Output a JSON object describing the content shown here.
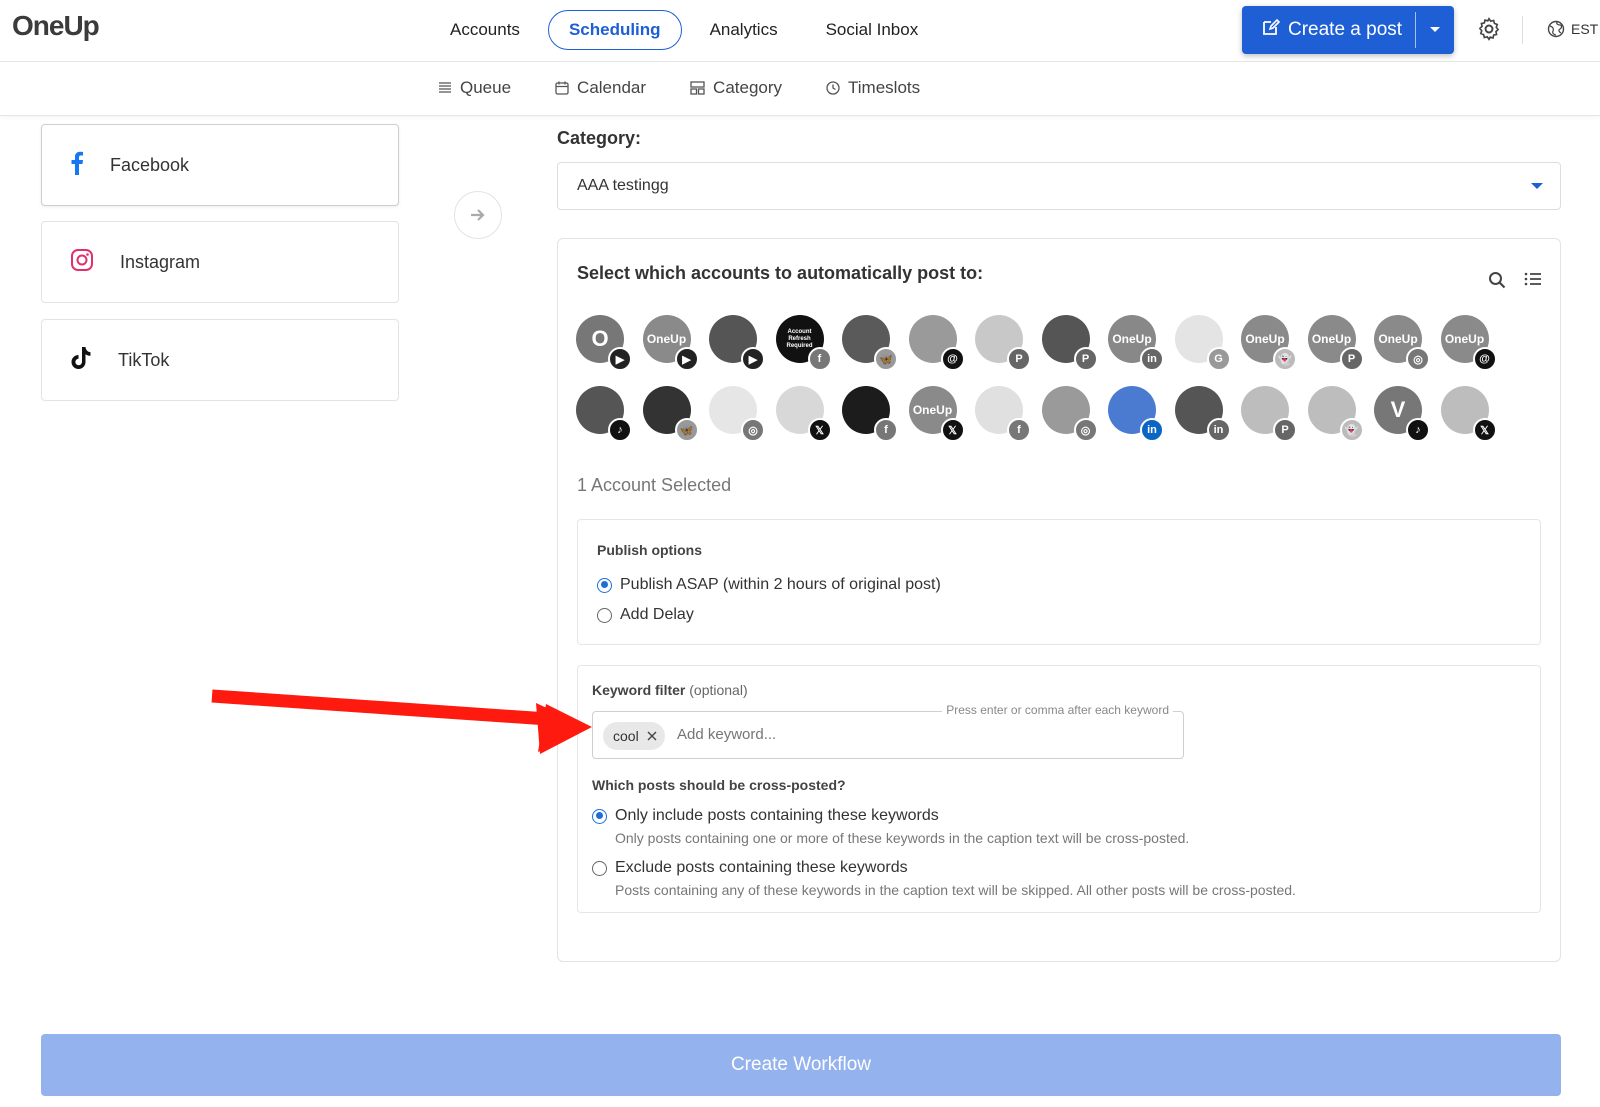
{
  "app": {
    "logo": "OneUp"
  },
  "nav": {
    "items": [
      {
        "label": "Accounts",
        "active": false
      },
      {
        "label": "Scheduling",
        "active": true
      },
      {
        "label": "Analytics",
        "active": false
      },
      {
        "label": "Social Inbox",
        "active": false
      }
    ],
    "create_label": "Create a post",
    "timezone": "EST"
  },
  "subnav": {
    "items": [
      {
        "label": "Queue",
        "icon": "list-icon"
      },
      {
        "label": "Calendar",
        "icon": "calendar-icon"
      },
      {
        "label": "Category",
        "icon": "category-icon"
      },
      {
        "label": "Timeslots",
        "icon": "clock-icon"
      }
    ]
  },
  "networks": [
    {
      "label": "Facebook",
      "icon": "facebook-icon",
      "color": "#1877f2"
    },
    {
      "label": "Instagram",
      "icon": "instagram-icon",
      "color": "#e1306c"
    },
    {
      "label": "TikTok",
      "icon": "tiktok-icon",
      "color": "#111111"
    }
  ],
  "category": {
    "label": "Category:",
    "selected": "AAA testingg"
  },
  "accounts": {
    "title": "Select which accounts to automatically post to:",
    "row1": [
      {
        "text": "O",
        "bg": "#777777",
        "badge": "youtube"
      },
      {
        "text": "OneUp",
        "bg": "#8a8a8a",
        "badge": "youtube"
      },
      {
        "text": "",
        "bg": "#555555",
        "badge": "youtube"
      },
      {
        "text": "Account Refresh Required",
        "bg": "#111111",
        "badge": "facebook"
      },
      {
        "text": "",
        "bg": "#5a5a5a",
        "badge": "bluesky"
      },
      {
        "text": "",
        "bg": "#9a9a9a",
        "badge": "threads"
      },
      {
        "text": "",
        "bg": "#c8c8c8",
        "badge": "pinterest"
      },
      {
        "text": "",
        "bg": "#555555",
        "badge": "pinterest"
      },
      {
        "text": "OneUp",
        "bg": "#888888",
        "badge": "linkedin"
      },
      {
        "text": "",
        "bg": "#e4e4e4",
        "badge": "google"
      },
      {
        "text": "OneUp",
        "bg": "#8a8a8a",
        "badge": "snapchat"
      },
      {
        "text": "OneUp",
        "bg": "#8a8a8a",
        "badge": "pinterest"
      },
      {
        "text": "OneUp",
        "bg": "#8a8a8a",
        "badge": "instagram"
      },
      {
        "text": "OneUp",
        "bg": "#8a8a8a",
        "badge": "threads"
      }
    ],
    "row2": [
      {
        "text": "",
        "bg": "#555555",
        "badge": "tiktok"
      },
      {
        "text": "",
        "bg": "#333333",
        "badge": "bluesky"
      },
      {
        "text": "",
        "bg": "#e6e6e6",
        "badge": "instagram"
      },
      {
        "text": "",
        "bg": "#d8d8d8",
        "badge": "x"
      },
      {
        "text": "",
        "bg": "#1c1c1c",
        "badge": "facebook"
      },
      {
        "text": "OneUp",
        "bg": "#8a8a8a",
        "badge": "x"
      },
      {
        "text": "",
        "bg": "#e0e0e0",
        "badge": "facebook"
      },
      {
        "text": "",
        "bg": "#9a9a9a",
        "badge": "instagram"
      },
      {
        "text": "",
        "bg": "#4a7bd0",
        "badge": "linkedin-blue"
      },
      {
        "text": "",
        "bg": "#555555",
        "badge": "linkedin"
      },
      {
        "text": "",
        "bg": "#bdbdbd",
        "badge": "pinterest"
      },
      {
        "text": "",
        "bg": "#bdbdbd",
        "badge": "snapchat"
      },
      {
        "text": "V",
        "bg": "#777777",
        "badge": "tiktok"
      },
      {
        "text": "",
        "bg": "#bdbdbd",
        "badge": "x"
      }
    ],
    "selected_count": "1 Account Selected"
  },
  "publish": {
    "label": "Publish options",
    "option1": "Publish ASAP (within 2 hours of original post)",
    "option2": "Add Delay",
    "selected": 1
  },
  "keyword_filter": {
    "label": "Keyword filter",
    "optional": "(optional)",
    "legend": "Press enter or comma after each keyword",
    "chips": [
      "cool"
    ],
    "placeholder": "Add keyword...",
    "question": "Which posts should be cross-posted?",
    "option1": "Only include posts containing these keywords",
    "option1_help": "Only posts containing one or more of these keywords in the caption text will be cross-posted.",
    "option2": "Exclude posts containing these keywords",
    "option2_help": "Posts containing any of these keywords in the caption text will be skipped. All other posts will be cross-posted.",
    "selected": 1
  },
  "footer": {
    "create_workflow": "Create Workflow"
  },
  "colors": {
    "accent": "#1e5fd6",
    "annotation_arrow": "#ff1a0f",
    "disabled_button": "#93b2ee"
  }
}
